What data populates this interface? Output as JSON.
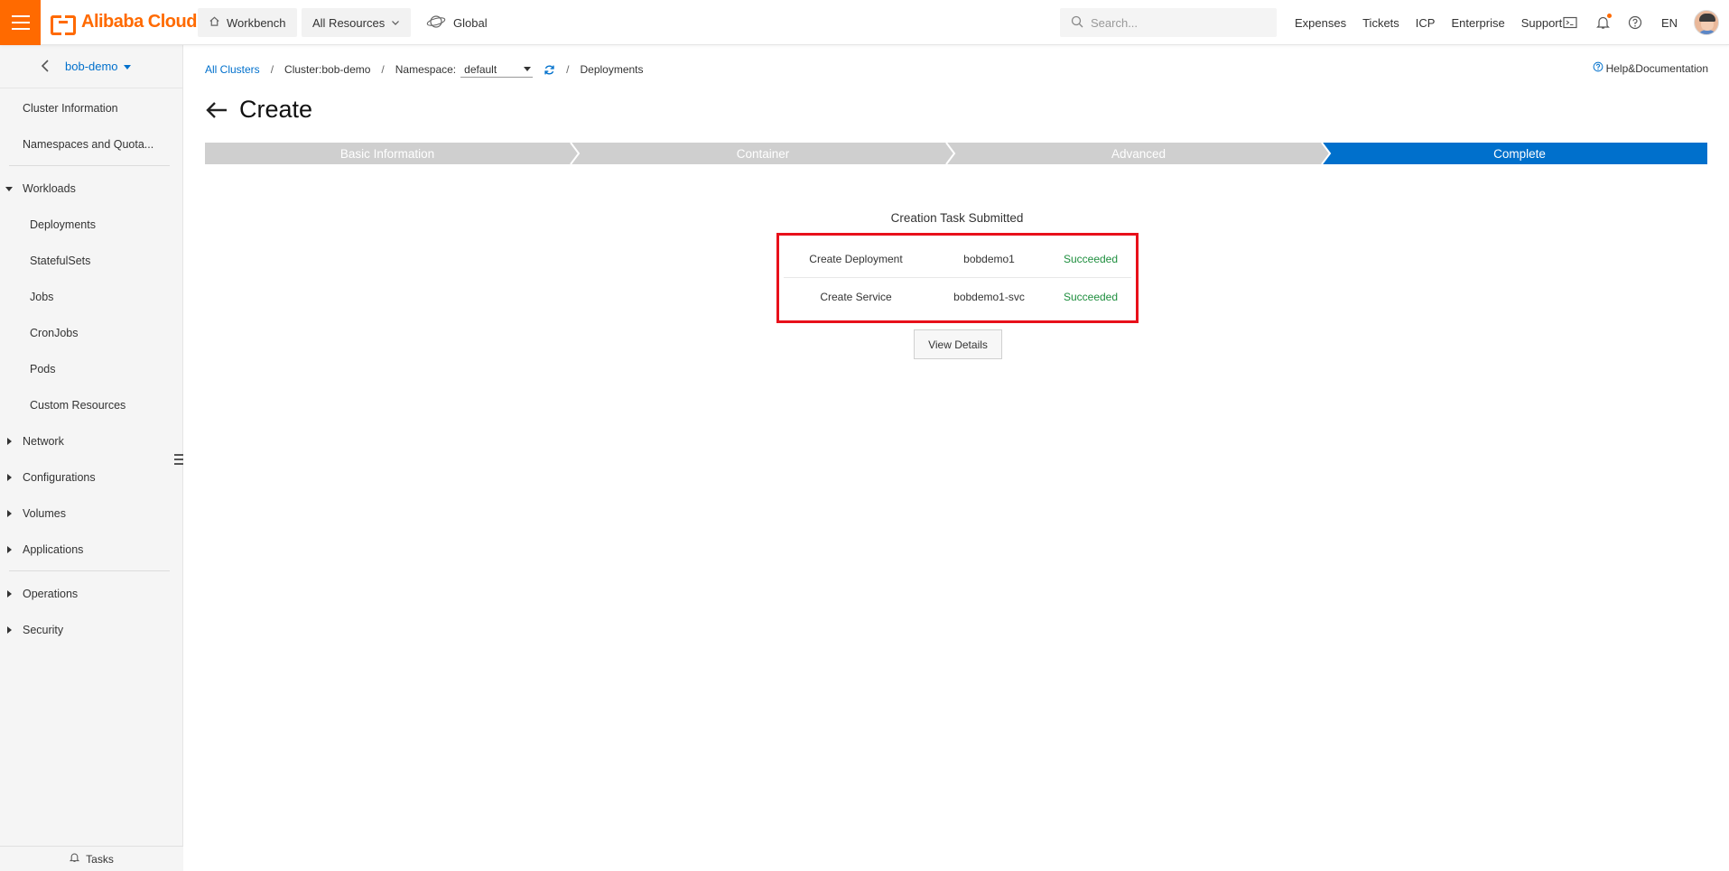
{
  "brand": {
    "name": "Alibaba Cloud",
    "color": "#ff6a00"
  },
  "topbar": {
    "workbench": "Workbench",
    "all_resources": "All Resources",
    "region": "Global",
    "search_placeholder": "Search...",
    "links": [
      "Expenses",
      "Tickets",
      "ICP",
      "Enterprise",
      "Support"
    ],
    "lang": "EN"
  },
  "sidebar": {
    "cluster": "bob-demo",
    "items": {
      "cluster_info": "Cluster Information",
      "namespaces": "Namespaces and Quota...",
      "workloads": "Workloads",
      "deployments": "Deployments",
      "statefulsets": "StatefulSets",
      "jobs": "Jobs",
      "cronjobs": "CronJobs",
      "pods": "Pods",
      "custom_resources": "Custom Resources",
      "network": "Network",
      "configurations": "Configurations",
      "volumes": "Volumes",
      "applications": "Applications",
      "operations": "Operations",
      "security": "Security"
    },
    "tasks": "Tasks"
  },
  "breadcrumb": {
    "all_clusters": "All Clusters",
    "cluster": "Cluster:bob-demo",
    "namespace_label": "Namespace:",
    "namespace_value": "default",
    "current": "Deployments"
  },
  "help": "Help&Documentation",
  "page": {
    "title": "Create"
  },
  "steps": [
    "Basic Information",
    "Container",
    "Advanced",
    "Complete"
  ],
  "result": {
    "title": "Creation Task Submitted",
    "tasks": [
      {
        "action": "Create Deployment",
        "name": "bobdemo1",
        "status": "Succeeded"
      },
      {
        "action": "Create Service",
        "name": "bobdemo1-svc",
        "status": "Succeeded"
      }
    ],
    "view_details": "View Details"
  },
  "colors": {
    "accent": "#0070cc",
    "success": "#1e8e3e",
    "highlight": "#e8101a",
    "step_done": "#cfcfcf"
  }
}
